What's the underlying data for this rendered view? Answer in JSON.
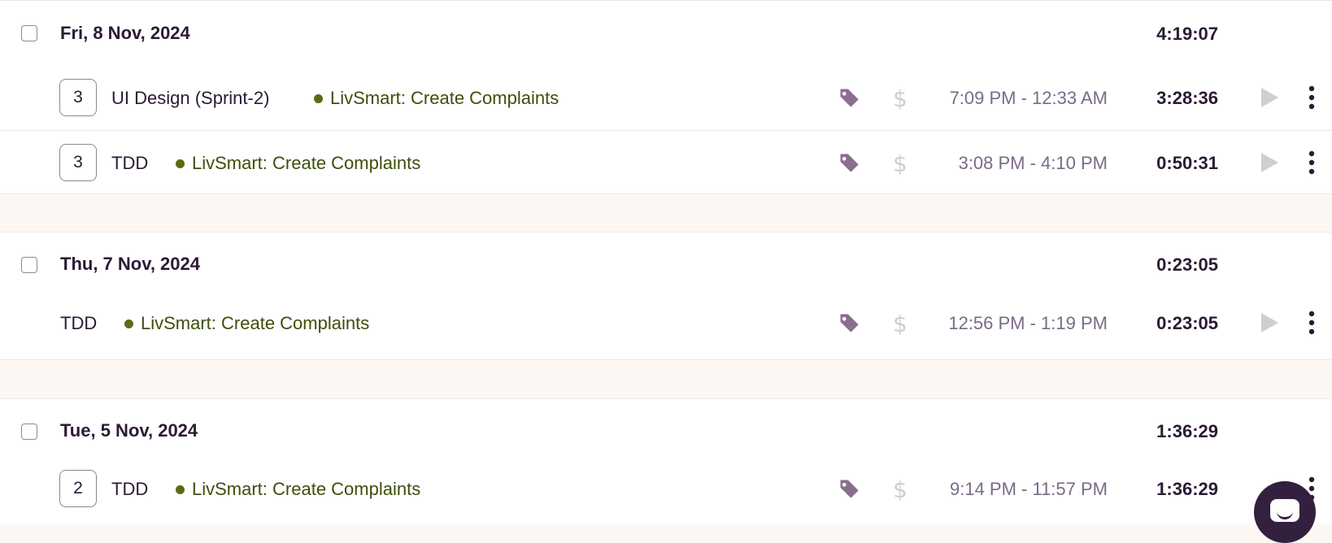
{
  "colors": {
    "accent": "#2b1a35",
    "project_green": "#3d4f0c",
    "muted": "#7a6a88",
    "separator_bg": "#fdf7f3"
  },
  "icons": {
    "tag": "tag-icon",
    "billable": "dollar-icon",
    "play": "play-icon",
    "more": "more-vertical-icon",
    "chat": "chat-icon"
  },
  "days": [
    {
      "date": "Fri, 8 Nov, 2024",
      "total": "4:19:07",
      "entries": [
        {
          "count": "3",
          "description": "UI Design (Sprint-2)",
          "project": "LivSmart: Create Complaints",
          "time_range": "7:09 PM - 12:33 AM",
          "duration": "3:28:36"
        },
        {
          "count": "3",
          "description": "TDD",
          "project": "LivSmart: Create Complaints",
          "time_range": "3:08 PM - 4:10 PM",
          "duration": "0:50:31"
        }
      ]
    },
    {
      "date": "Thu, 7 Nov, 2024",
      "total": "0:23:05",
      "entries": [
        {
          "description": "TDD",
          "project": "LivSmart: Create Complaints",
          "time_range": "12:56 PM - 1:19 PM",
          "duration": "0:23:05"
        }
      ]
    },
    {
      "date": "Tue, 5 Nov, 2024",
      "total": "1:36:29",
      "entries": [
        {
          "count": "2",
          "description": "TDD",
          "project": "LivSmart: Create Complaints",
          "time_range": "9:14 PM - 11:57 PM",
          "duration": "1:36:29"
        }
      ]
    }
  ]
}
